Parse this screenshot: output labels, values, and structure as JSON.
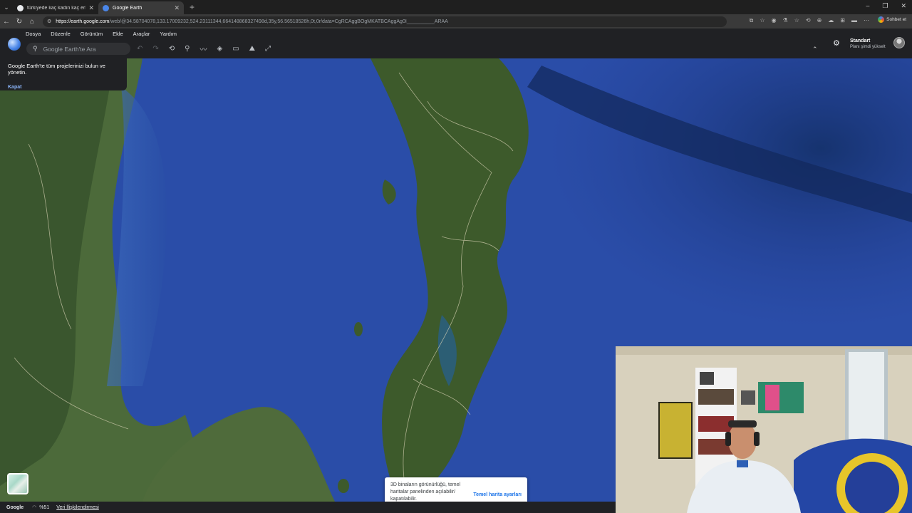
{
  "browser": {
    "tabs": [
      {
        "title": "türkiyede kaç kadın kaç erkek var -",
        "active": false,
        "favicon_color": "#e8eaed"
      },
      {
        "title": "Google Earth",
        "active": true,
        "favicon_color": "#4a86e8"
      }
    ],
    "url_host": "https://earth.google.com",
    "url_rest": "/web/@34.58704078,133.17009232,524.23111344,664148868327498d,35y,56.56518526h,0t,0r/data=CgRCAggBOgMKATBCAggAg0I__________ARAA",
    "sohbet_label": "Sohbet et"
  },
  "earth": {
    "menu": [
      "Dosya",
      "Düzenle",
      "Görünüm",
      "Ekle",
      "Araçlar",
      "Yardım"
    ],
    "search_placeholder": "Google Earth'te Ara",
    "plan_title": "Standart",
    "plan_sub": "Planı şimdi yükselt"
  },
  "projects_tip": {
    "text": "Google Earth'te tüm projelerinizi bulun ve yönetin.",
    "dismiss": "Kapat"
  },
  "toast": {
    "message": "3D binaların görünürlüğü, temel haritalar panelinden açılabilir/ kapatılabilir.",
    "action": "Temel harita ayarları"
  },
  "status": {
    "logo": "Google",
    "loading": "%51",
    "data_link": "Veri İlişkilendirmesi"
  },
  "colors": {
    "ocean": "#21459e",
    "land": "#3b5a2a",
    "accent_link": "#8ab4f8"
  },
  "icons": [
    "search-icon",
    "undo-icon",
    "redo-icon",
    "history-icon",
    "placemark-icon",
    "path-icon",
    "layers-icon",
    "ruler-icon",
    "measure-icon",
    "settings-icon",
    "globe-icon"
  ]
}
